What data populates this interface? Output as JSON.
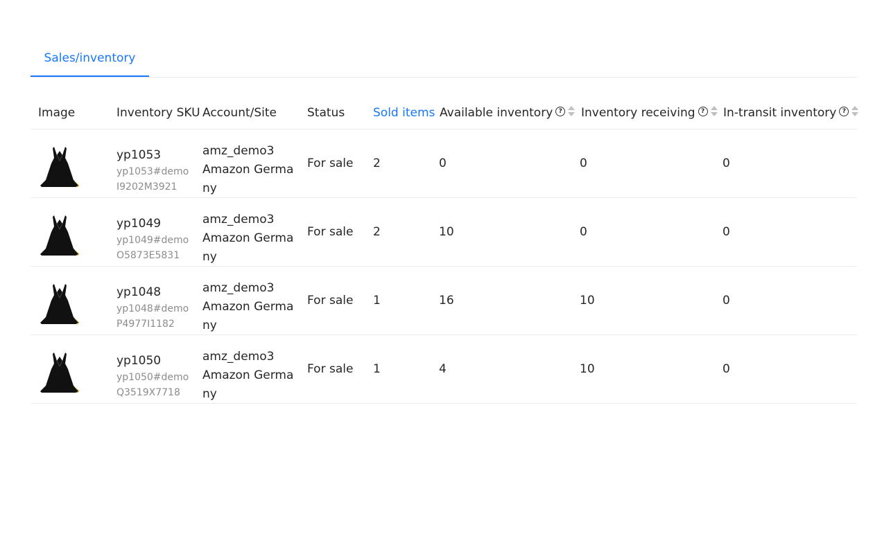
{
  "tabs": [
    {
      "label": "Sales/inventory",
      "active": true
    }
  ],
  "table": {
    "columns": [
      {
        "key": "image",
        "label": "Image"
      },
      {
        "key": "sku",
        "label": "Inventory SKU"
      },
      {
        "key": "account",
        "label": "Account/Site"
      },
      {
        "key": "status",
        "label": "Status"
      },
      {
        "key": "sold",
        "label": "Sold items",
        "active": true
      },
      {
        "key": "available",
        "label": "Available inventory",
        "help": true,
        "sortable": true
      },
      {
        "key": "receiving",
        "label": "Inventory receiving",
        "help": true,
        "sortable": true
      },
      {
        "key": "transit",
        "label": "In-transit inventory",
        "help": true,
        "sortable": true
      }
    ],
    "rows": [
      {
        "sku": "yp1053",
        "sku_sub_1": "yp1053#demo",
        "sku_sub_2": "I9202M3921",
        "account_1": "amz_demo3",
        "account_2": "Amazon Germa",
        "account_3": "ny",
        "status": "For sale",
        "sold": "2",
        "available": "0",
        "receiving": "0",
        "transit": "0"
      },
      {
        "sku": "yp1049",
        "sku_sub_1": "yp1049#demo",
        "sku_sub_2": "O5873E5831",
        "account_1": "amz_demo3",
        "account_2": "Amazon Germa",
        "account_3": "ny",
        "status": "For sale",
        "sold": "2",
        "available": "10",
        "receiving": "0",
        "transit": "0"
      },
      {
        "sku": "yp1048",
        "sku_sub_1": "yp1048#demo",
        "sku_sub_2": "P4977I1182",
        "account_1": "amz_demo3",
        "account_2": "Amazon Germa",
        "account_3": "ny",
        "status": "For sale",
        "sold": "1",
        "available": "16",
        "receiving": "10",
        "transit": "0"
      },
      {
        "sku": "yp1050",
        "sku_sub_1": "yp1050#demo",
        "sku_sub_2": "Q3519X7718",
        "account_1": "amz_demo3",
        "account_2": "Amazon Germa",
        "account_3": "ny",
        "status": "For sale",
        "sold": "1",
        "available": "4",
        "receiving": "10",
        "transit": "0"
      }
    ]
  },
  "help_icon_glyph": "?",
  "colors": {
    "accent": "#1677ff",
    "text": "#262626",
    "muted": "#8c8c8c",
    "border": "#ececec"
  }
}
